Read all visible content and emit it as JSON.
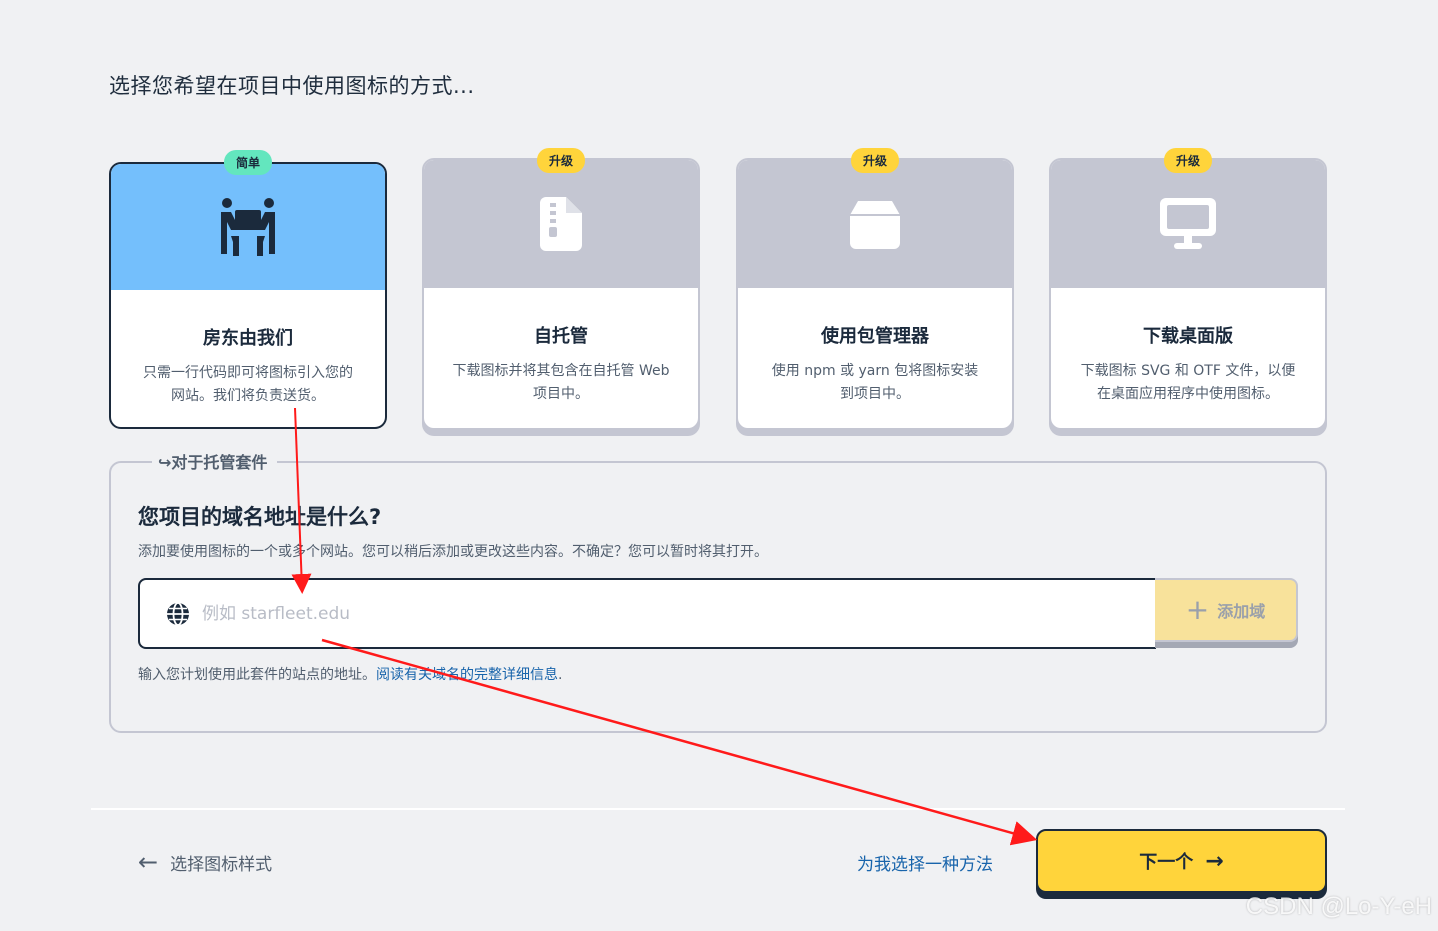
{
  "heading": "选择您希望在项目中使用图标的方式...",
  "cards": [
    {
      "badge": "简单",
      "title": "房东由我们",
      "desc": "只需一行代码即可将图标引入您的网站。我们将负责送货。",
      "icon": "people-carry-box-icon",
      "selected": true
    },
    {
      "badge": "升级",
      "title": "自托管",
      "desc": "下载图标并将其包含在自托管 Web 项目中。",
      "icon": "file-zipper-icon",
      "selected": false
    },
    {
      "badge": "升级",
      "title": "使用包管理器",
      "desc": "使用 npm 或 yarn 包将图标安装到项目中。",
      "icon": "box-icon",
      "selected": false
    },
    {
      "badge": "升级",
      "title": "下载桌面版",
      "desc": "下载图标 SVG 和 OTF 文件，以便在桌面应用程序中使用图标。",
      "icon": "desktop-icon",
      "selected": false
    }
  ],
  "kit_section": {
    "legend": "对于托管套件",
    "question": "您项目的域名地址是什么?",
    "description": "添加要使用图标的一个或多个网站。您可以稍后添加或更改这些内容。不确定？您可以暂时将其打开。",
    "input_placeholder": "例如 starfleet.edu",
    "input_value": "",
    "add_button": "添加域",
    "hint": "输入您计划使用此套件的站点的地址。",
    "hint_link": "阅读有关域名的完整详细信息",
    "hint_end": "."
  },
  "footer": {
    "back_label": "选择图标样式",
    "choose_label": "为我选择一种方法",
    "next_label": "下一个"
  },
  "watermark": "CSDN @Lo-Y-eH",
  "colors": {
    "selected_card_top": "#74bffc",
    "unselected_card_top": "#c4c6d2",
    "badge_simple": "#63e6be",
    "badge_upgrade": "#ffd43b",
    "next_button": "#ffd43b",
    "annotation_arrow": "#ff1a1a",
    "link": "#1864ab"
  }
}
